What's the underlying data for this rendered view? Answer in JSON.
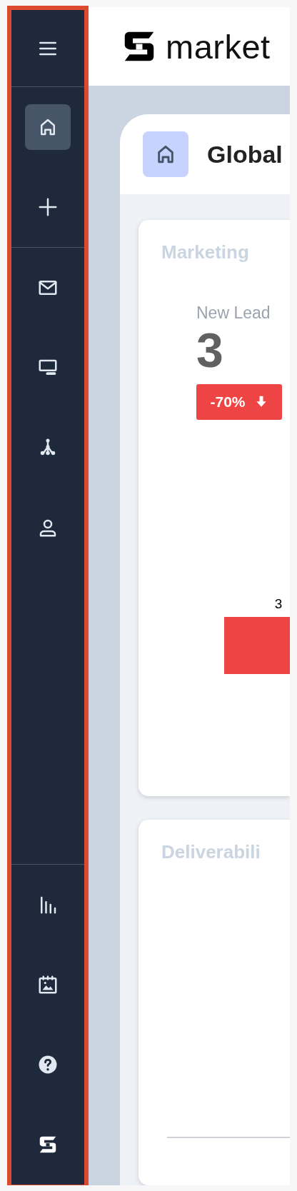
{
  "sidebar": {
    "groups": [
      {
        "items": [
          {
            "selected": true
          },
          {
            "selected": false
          }
        ]
      },
      {
        "items": [
          {
            "selected": false
          },
          {
            "selected": false
          },
          {
            "selected": false
          },
          {
            "selected": false
          }
        ]
      },
      {
        "items": [
          {
            "selected": false
          },
          {
            "selected": false
          },
          {
            "selected": false
          },
          {
            "selected": false
          }
        ]
      }
    ]
  },
  "header": {
    "brand": "market"
  },
  "panel": {
    "title": "Global"
  },
  "cards": [
    {
      "title": "Marketing",
      "metric": {
        "label": "New Lead",
        "value": "3",
        "change": "-70%",
        "kind": "down"
      },
      "bar_label": "3"
    },
    {
      "title": "Deliverabili"
    }
  ]
}
